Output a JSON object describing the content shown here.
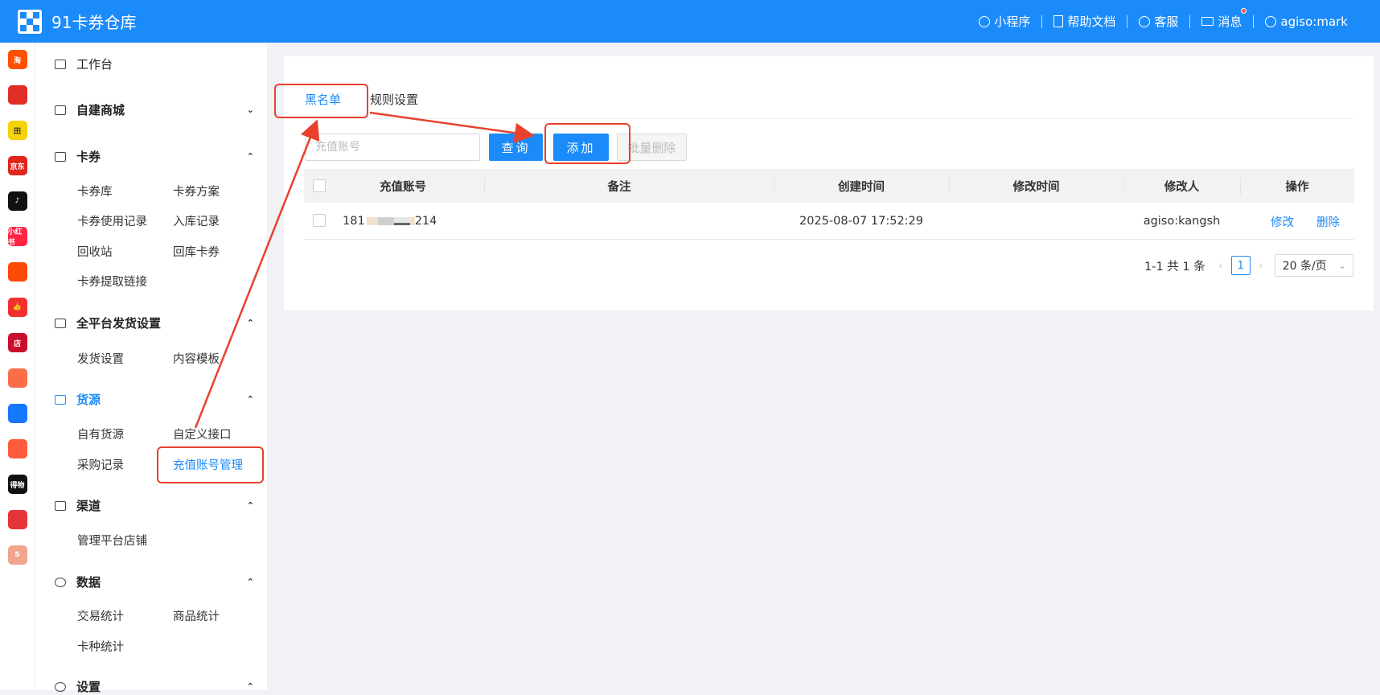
{
  "header": {
    "app_title": "91卡券仓库",
    "nav": [
      {
        "label": "小程序",
        "icon": "link-icon"
      },
      {
        "label": "帮助文档",
        "icon": "document-icon"
      },
      {
        "label": "客服",
        "icon": "headset-icon"
      },
      {
        "label": "消息",
        "icon": "mail-icon",
        "badge": true
      },
      {
        "label": "agiso:mark",
        "icon": "user-icon"
      }
    ]
  },
  "platform_rail": [
    {
      "name": "taobao-icon",
      "label": "淘",
      "color": "#ff5000"
    },
    {
      "name": "pinduoduo-icon",
      "label": "",
      "color": "#e02e24"
    },
    {
      "name": "tianmao-icon",
      "label": "田",
      "color": "#f5d20b"
    },
    {
      "name": "jd-icon",
      "label": "京东",
      "color": "#e1251b"
    },
    {
      "name": "douyin-icon",
      "label": "♪",
      "color": "#111111"
    },
    {
      "name": "xiaohongshu-icon",
      "label": "小红书",
      "color": "#ff2442"
    },
    {
      "name": "kuaishou-icon",
      "label": "",
      "color": "#ff4906"
    },
    {
      "name": "thumb-icon",
      "label": "👍",
      "color": "#f2302f"
    },
    {
      "name": "store-icon",
      "label": "店",
      "color": "#c8102e"
    },
    {
      "name": "bag-icon",
      "label": "",
      "color": "#fa6d47"
    },
    {
      "name": "chain-icon",
      "label": "",
      "color": "#1677ff"
    },
    {
      "name": "face-icon",
      "label": "",
      "color": "#ff5a3c"
    },
    {
      "name": "dewu-icon",
      "label": "得物",
      "color": "#111111"
    },
    {
      "name": "youzan-icon",
      "label": "",
      "color": "#e5343a"
    },
    {
      "name": "shop-icon",
      "label": "S",
      "color": "#f2a58e"
    }
  ],
  "sidebar": {
    "workbench": "工作台",
    "sections": [
      {
        "title": "自建商城",
        "chev": "⌄"
      },
      {
        "title": "卡券",
        "chev": "⌃",
        "items": [
          "卡券库",
          "卡券方案",
          "卡券使用记录",
          "入库记录",
          "回收站",
          "回库卡券",
          "卡券提取链接"
        ]
      },
      {
        "title": "全平台发货设置",
        "chev": "⌃",
        "items": [
          "发货设置",
          "内容模板"
        ]
      },
      {
        "title": "货源",
        "chev": "⌃",
        "items": [
          "自有货源",
          "自定义接口",
          "采购记录",
          "充值账号管理"
        ]
      },
      {
        "title": "渠道",
        "chev": "⌃",
        "items": [
          "管理平台店铺"
        ]
      },
      {
        "title": "数据",
        "chev": "⌃",
        "items": [
          "交易统计",
          "商品统计",
          "卡种统计"
        ]
      },
      {
        "title": "设置",
        "chev": "⌃"
      }
    ]
  },
  "main": {
    "tabs": [
      "黑名单",
      "规则设置"
    ],
    "search_placeholder": "充值账号",
    "buttons": {
      "query": "查询",
      "add": "添加",
      "batch_delete": "批量删除"
    },
    "table": {
      "headers": [
        "充值账号",
        "备注",
        "创建时间",
        "修改时间",
        "修改人",
        "操作"
      ],
      "rows": [
        {
          "account_prefix": "181",
          "account_suffix": "214",
          "note": "",
          "created": "2025-08-07 17:52:29",
          "modified": "",
          "modifier": "agiso:kangsh",
          "actions": [
            "修改",
            "删除"
          ]
        }
      ]
    },
    "pagination": {
      "summary": "1-1 共 1 条",
      "current": "1",
      "page_size": "20 条/页"
    }
  },
  "colors": {
    "primary": "#1b8bfa",
    "annotation": "#e8412e"
  }
}
